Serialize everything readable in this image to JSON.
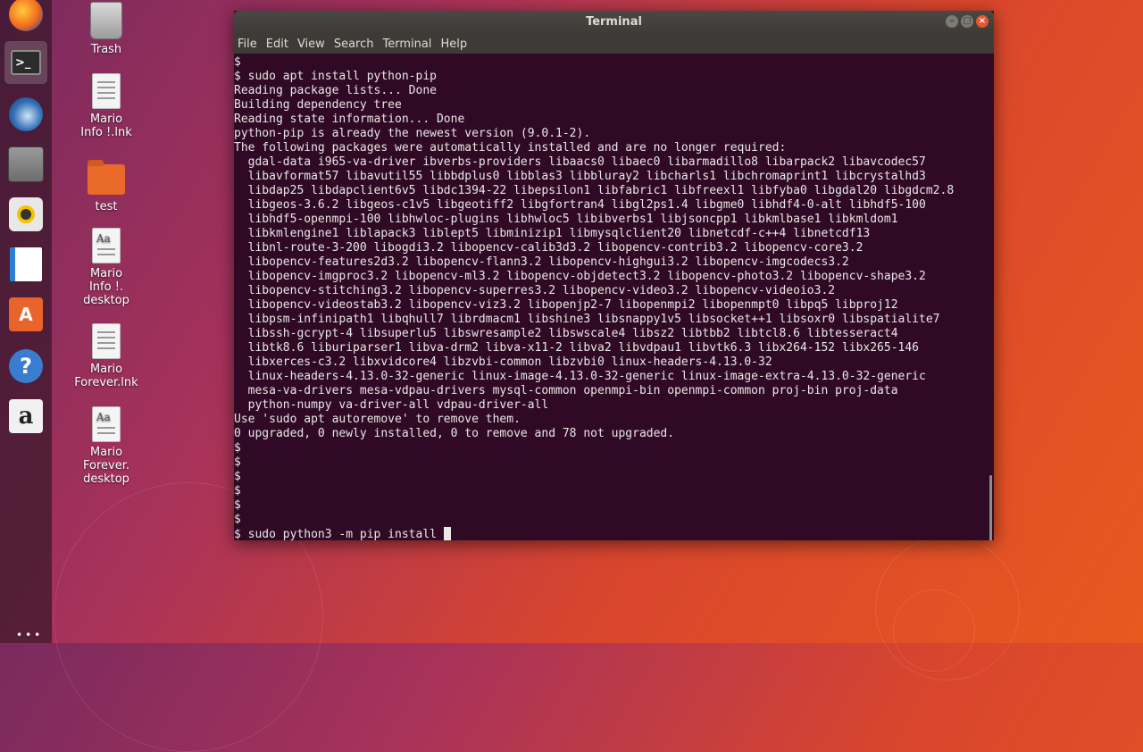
{
  "desktop": {
    "icons": [
      {
        "label": "Trash"
      },
      {
        "label": "Mario\nInfo !.lnk"
      },
      {
        "label": "test"
      },
      {
        "label": "Mario\nInfo !.\ndesktop"
      },
      {
        "label": "Mario\nForever.lnk"
      },
      {
        "label": "Mario\nForever.\ndesktop"
      }
    ]
  },
  "launcher": {
    "items": [
      {
        "name": "firefox-icon"
      },
      {
        "name": "terminal-icon"
      },
      {
        "name": "thunderbird-icon"
      },
      {
        "name": "files-icon"
      },
      {
        "name": "rhythmbox-icon"
      },
      {
        "name": "writer-icon"
      },
      {
        "name": "software-center-icon"
      },
      {
        "name": "help-icon"
      },
      {
        "name": "amazon-icon"
      }
    ],
    "software_glyph": "A",
    "help_glyph": "?",
    "amazon_glyph": "a"
  },
  "window": {
    "title": "Terminal",
    "menu": [
      "File",
      "Edit",
      "View",
      "Search",
      "Terminal",
      "Help"
    ]
  },
  "terminal": {
    "lines": [
      "$",
      "$ sudo apt install python-pip",
      "Reading package lists... Done",
      "Building dependency tree",
      "Reading state information... Done",
      "python-pip is already the newest version (9.0.1-2).",
      "The following packages were automatically installed and are no longer required:",
      "  gdal-data i965-va-driver ibverbs-providers libaacs0 libaec0 libarmadillo8 libarpack2 libavcodec57",
      "  libavformat57 libavutil55 libbdplus0 libblas3 libbluray2 libcharls1 libchromaprint1 libcrystalhd3",
      "  libdap25 libdapclient6v5 libdc1394-22 libepsilon1 libfabric1 libfreexl1 libfyba0 libgdal20 libgdcm2.8",
      "  libgeos-3.6.2 libgeos-c1v5 libgeotiff2 libgfortran4 libgl2ps1.4 libgme0 libhdf4-0-alt libhdf5-100",
      "  libhdf5-openmpi-100 libhwloc-plugins libhwloc5 libibverbs1 libjsoncpp1 libkmlbase1 libkmldom1",
      "  libkmlengine1 liblapack3 liblept5 libminizip1 libmysqlclient20 libnetcdf-c++4 libnetcdf13",
      "  libnl-route-3-200 libogdi3.2 libopencv-calib3d3.2 libopencv-contrib3.2 libopencv-core3.2",
      "  libopencv-features2d3.2 libopencv-flann3.2 libopencv-highgui3.2 libopencv-imgcodecs3.2",
      "  libopencv-imgproc3.2 libopencv-ml3.2 libopencv-objdetect3.2 libopencv-photo3.2 libopencv-shape3.2",
      "  libopencv-stitching3.2 libopencv-superres3.2 libopencv-video3.2 libopencv-videoio3.2",
      "  libopencv-videostab3.2 libopencv-viz3.2 libopenjp2-7 libopenmpi2 libopenmpt0 libpq5 libproj12",
      "  libpsm-infinipath1 libqhull7 librdmacm1 libshine3 libsnappy1v5 libsocket++1 libsoxr0 libspatialite7",
      "  libssh-gcrypt-4 libsuperlu5 libswresample2 libswscale4 libsz2 libtbb2 libtcl8.6 libtesseract4",
      "  libtk8.6 liburiparser1 libva-drm2 libva-x11-2 libva2 libvdpau1 libvtk6.3 libx264-152 libx265-146",
      "  libxerces-c3.2 libxvidcore4 libzvbi-common libzvbi0 linux-headers-4.13.0-32",
      "  linux-headers-4.13.0-32-generic linux-image-4.13.0-32-generic linux-image-extra-4.13.0-32-generic",
      "  mesa-va-drivers mesa-vdpau-drivers mysql-common openmpi-bin openmpi-common proj-bin proj-data",
      "  python-numpy va-driver-all vdpau-driver-all",
      "Use 'sudo apt autoremove' to remove them.",
      "0 upgraded, 0 newly installed, 0 to remove and 78 not upgraded.",
      "$",
      "$",
      "$",
      "$",
      "$",
      "$"
    ],
    "prompt_line": "$ sudo python3 -m pip install "
  }
}
